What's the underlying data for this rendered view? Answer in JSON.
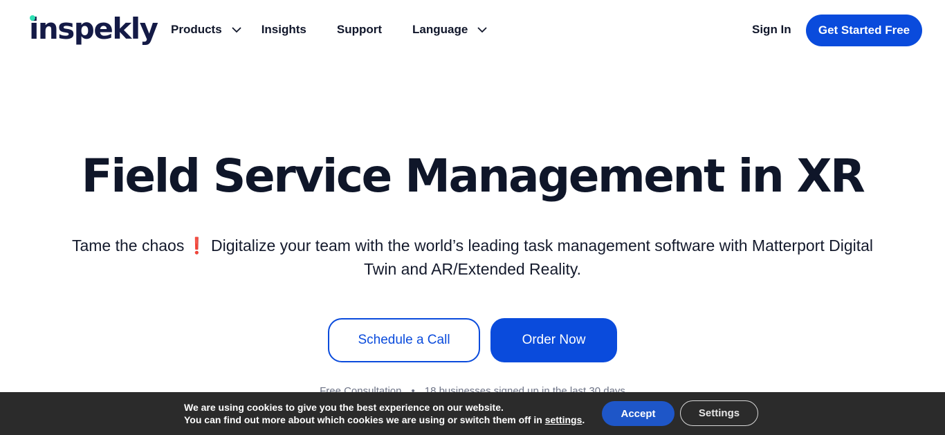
{
  "header": {
    "logo_text": "inspekly",
    "nav": {
      "products": "Products",
      "insights": "Insights",
      "support": "Support",
      "language": "Language"
    },
    "sign_in": "Sign In",
    "get_started": "Get Started Free"
  },
  "hero": {
    "title": "Field Service Management in XR",
    "subtitle_part1": "Tame the chaos",
    "subtitle_emoji": "❗",
    "subtitle_part2": "Digitalize your team with the world’s leading task management software with Matterport Digital Twin and AR/Extended Reality.",
    "schedule_call": "Schedule a Call",
    "order_now": "Order Now",
    "meta_left": "Free Consultation",
    "meta_sep": "•",
    "meta_right": "18 businesses signed up in the last 30 days"
  },
  "cookie_bar": {
    "line1": "We are using cookies to give you the best experience on our website.",
    "line2_prefix": "You can find out more about which cookies we are using or switch them off in",
    "settings_link": "settings",
    "line2_suffix": ".",
    "accept": "Accept",
    "settings": "Settings"
  },
  "colors": {
    "brand_blue": "#0a4bdc",
    "logo_navy": "#141a46",
    "logo_dot": "#2fe0b4",
    "cookie_bg": "#2b2b2b"
  }
}
